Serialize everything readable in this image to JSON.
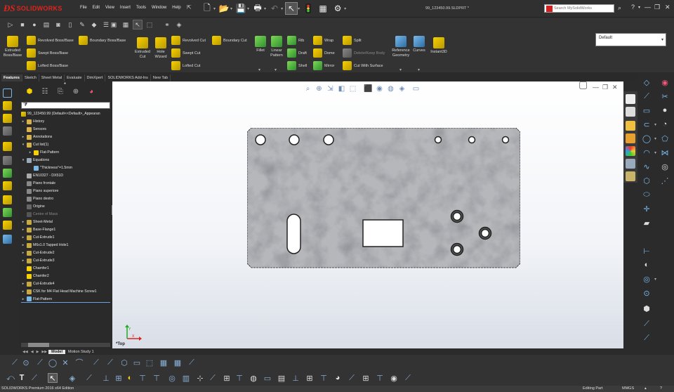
{
  "app": {
    "logo_text": "SOLIDWORKS",
    "document_title": "99_123450.99.SLDPRT *",
    "menu": [
      "File",
      "Edit",
      "View",
      "Insert",
      "Tools",
      "Window",
      "Help"
    ],
    "search_placeholder": "Search MySolidWorks"
  },
  "command_manager": {
    "features": {
      "extruded_boss": "Extruded Boss/Base",
      "revolved_boss": "Revolved Boss/Base",
      "swept_boss": "Swept Boss/Base",
      "lofted_boss": "Lofted Boss/Base",
      "boundary_boss": "Boundary Boss/Base",
      "extruded_cut": "Extruded Cut",
      "hole_wizard": "Hole Wizard",
      "revolved_cut": "Revolved Cut",
      "swept_cut": "Swept Cut",
      "lofted_cut": "Lofted Cut",
      "boundary_cut": "Boundary Cut",
      "fillet": "Fillet",
      "linear_pattern": "Linear Pattern",
      "rib": "Rib",
      "draft": "Draft",
      "shell": "Shell",
      "wrap": "Wrap",
      "dome": "Dome",
      "mirror": "Mirror",
      "split": "Split",
      "delete_keep_body": "Delete/Keep Body",
      "cut_with_surface": "Cut With Surface",
      "reference_geometry": "Reference Geometry",
      "curves": "Curves",
      "instant3d": "Instant3D"
    },
    "configuration": "Default"
  },
  "tabs": [
    "Features",
    "Sketch",
    "Sheet Metal",
    "Evaluate",
    "DimXpert",
    "SOLIDWORKS Add-Ins",
    "New Tab"
  ],
  "active_tab": "Features",
  "feature_tree": {
    "filter_icon": "filter-icon",
    "root": "99_123450.99  (Default<<Default>_Appearan",
    "nodes": [
      {
        "label": "History",
        "icon": "history-icon"
      },
      {
        "label": "Sensors",
        "icon": "sensor-icon"
      },
      {
        "label": "Annotations",
        "icon": "annotations-icon"
      },
      {
        "label": "Cut list(1)",
        "icon": "cutlist-icon"
      },
      {
        "label": "Flat-Pattern",
        "icon": "folder-icon"
      },
      {
        "label": "Equations",
        "icon": "equations-icon"
      },
      {
        "label": "\"Thickness\"=1.5mm",
        "icon": "equation-icon"
      },
      {
        "label": "EN10327 - DX51D",
        "icon": "material-icon"
      },
      {
        "label": "Piano frontale",
        "icon": "plane-icon"
      },
      {
        "label": "Piano superiore",
        "icon": "plane-icon"
      },
      {
        "label": "Piano destro",
        "icon": "plane-icon"
      },
      {
        "label": "Origine",
        "icon": "origin-icon"
      },
      {
        "label": "Centre of Mass",
        "icon": "com-icon"
      },
      {
        "label": "Sheet-Metal",
        "icon": "sheetmetal-icon"
      },
      {
        "label": "Base-Flange1",
        "icon": "flange-icon"
      },
      {
        "label": "Cut-Extrude1",
        "icon": "cut-icon"
      },
      {
        "label": "M6x1.0 Tapped Hole1",
        "icon": "hole-icon"
      },
      {
        "label": "Cut-Extrude2",
        "icon": "cut-icon"
      },
      {
        "label": "Cut-Extrude3",
        "icon": "cut-icon"
      },
      {
        "label": "Chamfer1",
        "icon": "chamfer-icon"
      },
      {
        "label": "Chamfer2",
        "icon": "chamfer-icon"
      },
      {
        "label": "Cut-Extrude4",
        "icon": "cut-icon"
      },
      {
        "label": "CSK for M4 Flat Head Machine Screw1",
        "icon": "hole-icon"
      },
      {
        "label": "Flat-Pattern",
        "icon": "flatpattern-icon"
      }
    ]
  },
  "viewport": {
    "view_label": "*Top",
    "triad_x": "X",
    "triad_y": "Y"
  },
  "model_tabs": [
    "Model",
    "Motion Study 1"
  ],
  "status": {
    "left": "SOLIDWORKS Premium 2016 x64 Edition",
    "mode": "Editing Part",
    "units": "MMGS"
  }
}
